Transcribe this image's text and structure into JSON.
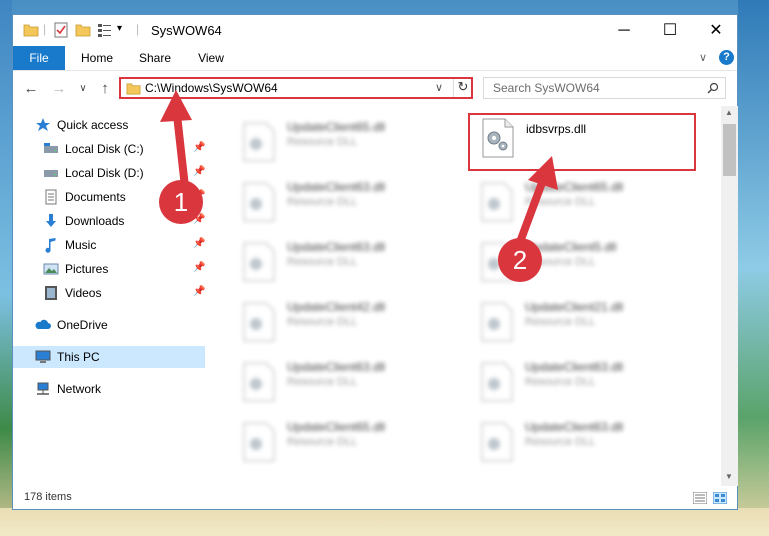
{
  "window": {
    "title": "SysWOW64",
    "minimize_label": "─",
    "maximize_label": "☐",
    "close_label": "✕"
  },
  "ribbon": {
    "tabs": [
      "File",
      "Home",
      "Share",
      "View"
    ],
    "expand_label": "∨",
    "help_label": "?"
  },
  "nav": {
    "back_label": "←",
    "forward_label": "→",
    "recent_label": "∨",
    "up_label": "↑"
  },
  "address": {
    "path": "C:\\Windows\\SysWOW64",
    "dropdown_label": "∨",
    "refresh_label": "↻"
  },
  "search": {
    "placeholder": "Search SysWOW64",
    "icon": "search-icon"
  },
  "sidebar": {
    "items": [
      {
        "label": "Quick access",
        "icon": "star-icon",
        "pinned": false
      },
      {
        "label": "Local Disk (C:)",
        "icon": "drive-icon",
        "pinned": true
      },
      {
        "label": "Local Disk (D:)",
        "icon": "drive-icon",
        "pinned": true
      },
      {
        "label": "Documents",
        "icon": "documents-icon",
        "pinned": true
      },
      {
        "label": "Downloads",
        "icon": "download-icon",
        "pinned": true
      },
      {
        "label": "Music",
        "icon": "music-icon",
        "pinned": true
      },
      {
        "label": "Pictures",
        "icon": "pictures-icon",
        "pinned": true
      },
      {
        "label": "Videos",
        "icon": "videos-icon",
        "pinned": true
      },
      {
        "label": "OneDrive",
        "icon": "cloud-icon",
        "pinned": false
      },
      {
        "label": "This PC",
        "icon": "computer-icon",
        "pinned": false,
        "selected": true
      },
      {
        "label": "Network",
        "icon": "network-icon",
        "pinned": false
      }
    ]
  },
  "files": {
    "highlighted": {
      "name": "idbsvrps.dll",
      "type": ""
    },
    "left_column": [
      {
        "name": "UpdateClient65.dll",
        "type": "Resource DLL"
      },
      {
        "name": "UpdateClient63.dll",
        "type": "Resource DLL"
      },
      {
        "name": "UpdateClient63.dll",
        "type": "Resource DLL"
      },
      {
        "name": "UpdateClient42.dll",
        "type": "Resource DLL"
      },
      {
        "name": "UpdateClient63.dll",
        "type": "Resource DLL"
      },
      {
        "name": "UpdateClient65.dll",
        "type": "Resource DLL"
      }
    ],
    "right_column": [
      {
        "name": "UpdateClient65.dll",
        "type": "Resource DLL"
      },
      {
        "name": "UpdateClient5.dll",
        "type": "Resource DLL"
      },
      {
        "name": "UpdateClient21.dll",
        "type": "Resource DLL"
      },
      {
        "name": "UpdateClient63.dll",
        "type": "Resource DLL"
      },
      {
        "name": "UpdateClient63.dll",
        "type": "Resource DLL"
      }
    ]
  },
  "status": {
    "item_count": "178 items"
  },
  "annotations": {
    "step1": "1",
    "step2": "2",
    "color": "#d9363e"
  }
}
